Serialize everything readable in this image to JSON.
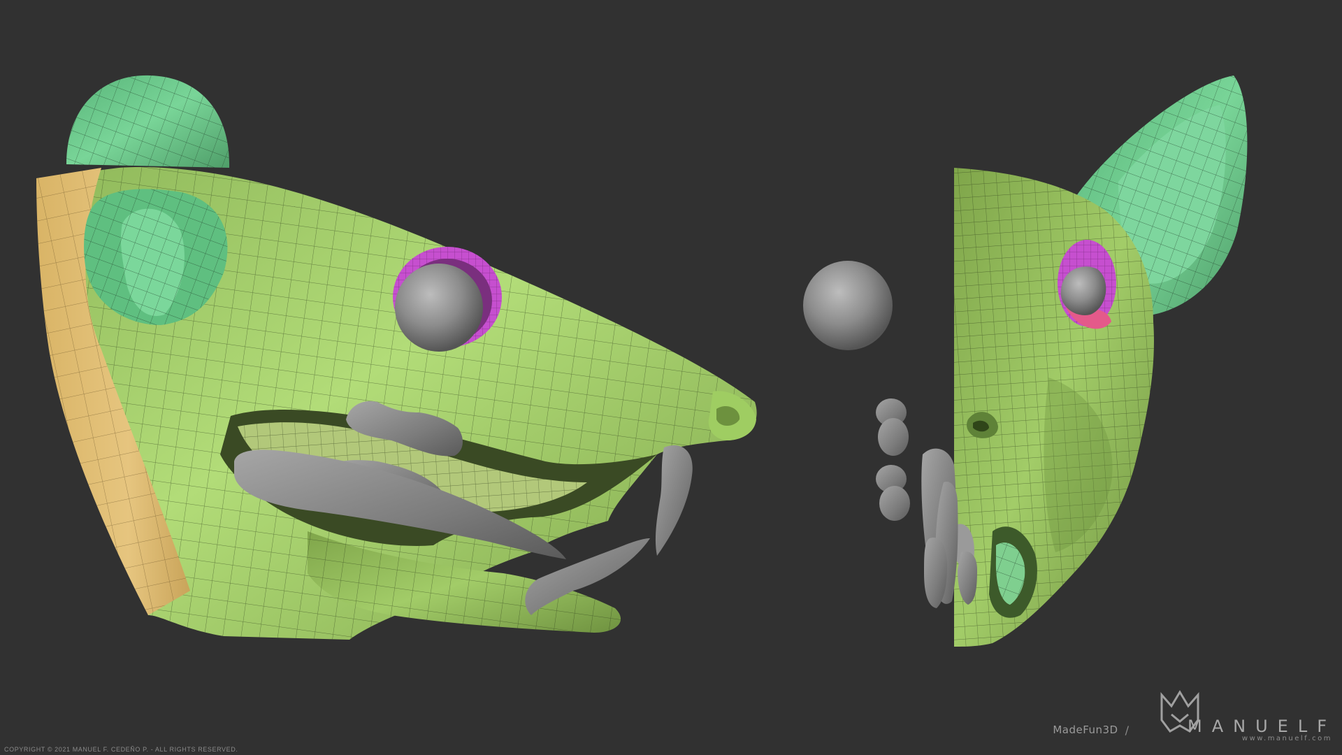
{
  "footer": {
    "copyright": "COPYRIGHT © 2021 MANUEL F. CEDEÑO P. - ALL RIGHTS RESERVED.",
    "studio": "MadeFun3D",
    "separator": "/",
    "brand_name": "MANUELF",
    "brand_url": "www.manuelf.com",
    "logo_icon": "manuelf-mask-logo-icon"
  },
  "colors": {
    "background": "#313131",
    "skin_green": "#a8d66c",
    "ear_green": "#6fcf8e",
    "neck_tan": "#e3bf72",
    "eyelid_magenta": "#c94fd0",
    "teeth_gray": "#8f8f8f",
    "wireframe": "#2b3a1a"
  },
  "views": [
    {
      "name": "side",
      "description": "rat head side view"
    },
    {
      "name": "front",
      "description": "rat head half front view"
    }
  ]
}
